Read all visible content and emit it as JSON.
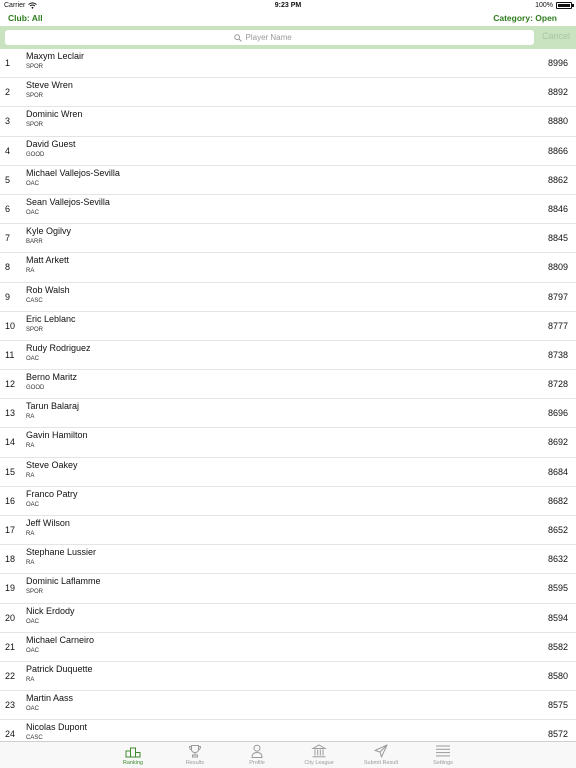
{
  "status_bar": {
    "carrier": "Carrier",
    "time": "9:23 PM",
    "battery": "100%",
    "battery_level": 1.0
  },
  "filters": {
    "club": "Club: All",
    "category": "Category: Open"
  },
  "search": {
    "placeholder": "Player Name",
    "value": "",
    "cancel": "Cancel",
    "icon": "search-icon"
  },
  "players": [
    {
      "rank": "1",
      "name": "Maxym Leclair",
      "club": "SPOR",
      "score": "8996"
    },
    {
      "rank": "2",
      "name": "Steve Wren",
      "club": "SPOR",
      "score": "8892"
    },
    {
      "rank": "3",
      "name": "Dominic Wren",
      "club": "SPOR",
      "score": "8880"
    },
    {
      "rank": "4",
      "name": "David Guest",
      "club": "GOOD",
      "score": "8866"
    },
    {
      "rank": "5",
      "name": "Michael Vallejos-Sevilla",
      "club": "OAC",
      "score": "8862"
    },
    {
      "rank": "6",
      "name": "Sean Vallejos-Sevilla",
      "club": "OAC",
      "score": "8846"
    },
    {
      "rank": "7",
      "name": "Kyle Ogilvy",
      "club": "BARR",
      "score": "8845"
    },
    {
      "rank": "8",
      "name": "Matt Arkett",
      "club": "RA",
      "score": "8809"
    },
    {
      "rank": "9",
      "name": "Rob Walsh",
      "club": "CASC",
      "score": "8797"
    },
    {
      "rank": "10",
      "name": "Eric Leblanc",
      "club": "SPOR",
      "score": "8777"
    },
    {
      "rank": "11",
      "name": "Rudy Rodriguez",
      "club": "OAC",
      "score": "8738"
    },
    {
      "rank": "12",
      "name": "Berno Maritz",
      "club": "GOOD",
      "score": "8728"
    },
    {
      "rank": "13",
      "name": "Tarun Balaraj",
      "club": "RA",
      "score": "8696"
    },
    {
      "rank": "14",
      "name": "Gavin Hamilton",
      "club": "RA",
      "score": "8692"
    },
    {
      "rank": "15",
      "name": "Steve Oakey",
      "club": "RA",
      "score": "8684"
    },
    {
      "rank": "16",
      "name": "Franco Patry",
      "club": "OAC",
      "score": "8682"
    },
    {
      "rank": "17",
      "name": "Jeff Wilson",
      "club": "RA",
      "score": "8652"
    },
    {
      "rank": "18",
      "name": "Stephane Lussier",
      "club": "RA",
      "score": "8632"
    },
    {
      "rank": "19",
      "name": "Dominic Laflamme",
      "club": "SPOR",
      "score": "8595"
    },
    {
      "rank": "20",
      "name": "Nick Erdody",
      "club": "OAC",
      "score": "8594"
    },
    {
      "rank": "21",
      "name": "Michael Carneiro",
      "club": "OAC",
      "score": "8582"
    },
    {
      "rank": "22",
      "name": "Patrick Duquette",
      "club": "RA",
      "score": "8580"
    },
    {
      "rank": "23",
      "name": "Martin Aass",
      "club": "OAC",
      "score": "8575"
    },
    {
      "rank": "24",
      "name": "Nicolas Dupont",
      "club": "CASC",
      "score": "8572"
    }
  ],
  "tabs": [
    {
      "label": "Ranking",
      "icon": "podium-icon",
      "active": true
    },
    {
      "label": "Results",
      "icon": "trophy-icon",
      "active": false
    },
    {
      "label": "Profile",
      "icon": "person-icon",
      "active": false
    },
    {
      "label": "City League",
      "icon": "building-icon",
      "active": false
    },
    {
      "label": "Submit Result",
      "icon": "send-icon",
      "active": false
    },
    {
      "label": "Settings",
      "icon": "list-icon",
      "active": false
    }
  ],
  "colors": {
    "accent": "#2e7d1e",
    "search_bar_bg": "#c9e2c0",
    "tab_inactive": "#9a9a9a",
    "tab_active": "#3f8a2d"
  }
}
